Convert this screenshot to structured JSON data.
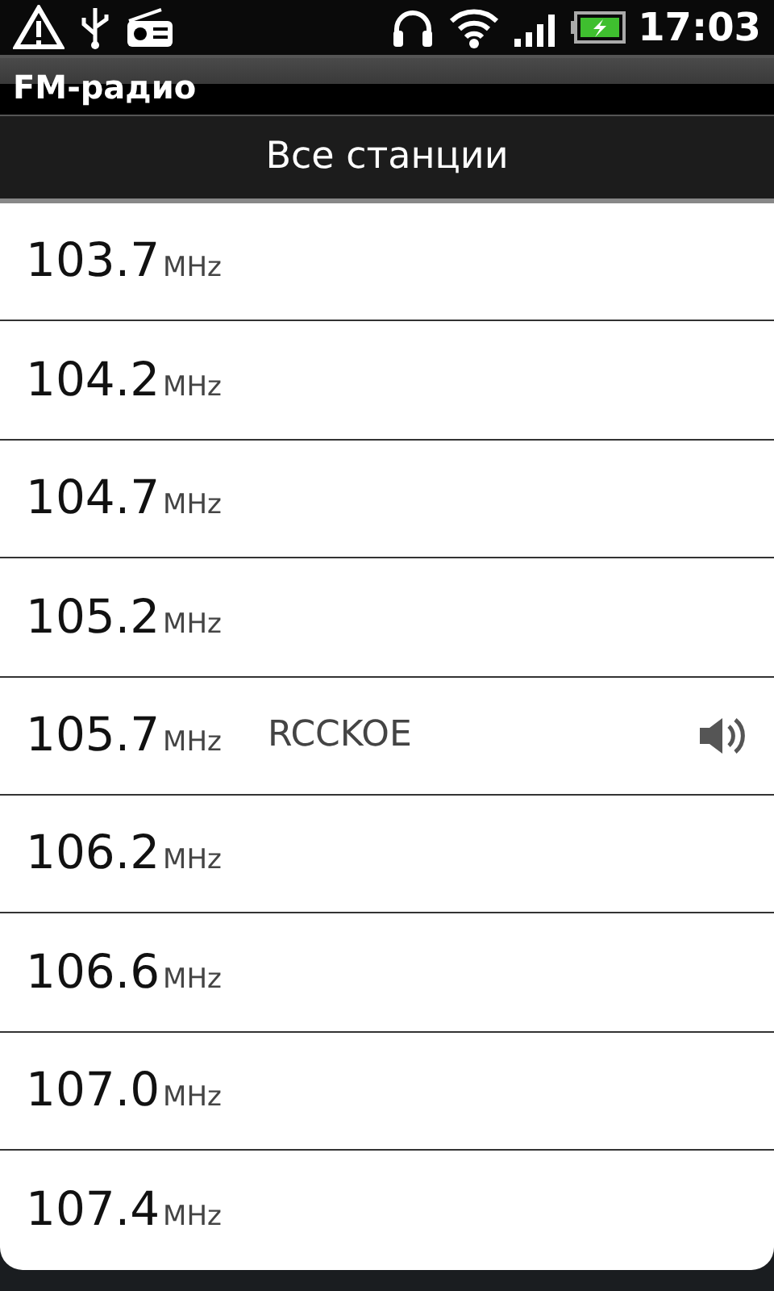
{
  "status_bar": {
    "time": "17:03"
  },
  "app_title": "FM-радио",
  "header": "Все станции",
  "stations": [
    {
      "frequency": "103.7",
      "unit": "MHz",
      "playing": false
    },
    {
      "frequency": "104.2",
      "unit": "MHz",
      "playing": false
    },
    {
      "frequency": "104.7",
      "unit": "MHz",
      "playing": false
    },
    {
      "frequency": "105.2",
      "unit": "MHz",
      "playing": false
    },
    {
      "frequency": "105.7",
      "unit": "MHz",
      "name": "RCCKOE",
      "playing": true
    },
    {
      "frequency": "106.2",
      "unit": "MHz",
      "playing": false
    },
    {
      "frequency": "106.6",
      "unit": "MHz",
      "playing": false
    },
    {
      "frequency": "107.0",
      "unit": "MHz",
      "playing": false
    },
    {
      "frequency": "107.4",
      "unit": "MHz",
      "playing": false
    }
  ]
}
